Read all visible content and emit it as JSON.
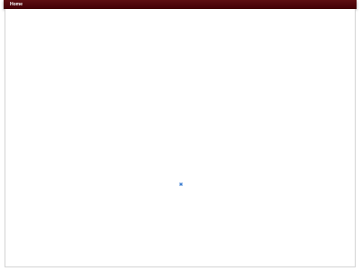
{
  "nav": {
    "home_label": "Home",
    "accent_color": "#4d050b"
  },
  "loading": {
    "icon": "loading-icon",
    "color": "#3f7fd0"
  }
}
